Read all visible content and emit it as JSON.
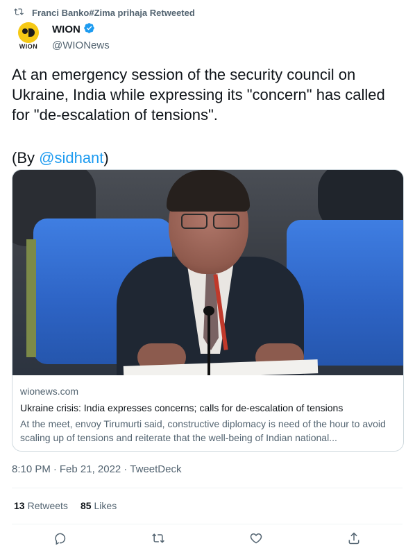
{
  "social_context": {
    "text": "Franci Banko#Zima prihaja Retweeted"
  },
  "author": {
    "display_name": "WION",
    "handle": "@WIONews",
    "avatar_text": "WION"
  },
  "tweet": {
    "text_main": "At an emergency session of the security council on Ukraine, India while expressing its \"concern\" has called for \"de-escalation of tensions\".",
    "by_prefix": "(By ",
    "mention": "@sidhant",
    "by_suffix": ")"
  },
  "card": {
    "domain": "wionews.com",
    "title": "Ukraine crisis: India expresses concerns; calls for de-escalation of tensions",
    "description": "At the meet, envoy Tirumurti said, constructive diplomacy is need of the hour to avoid scaling up of tensions and reiterate that the well-being of Indian national..."
  },
  "meta": {
    "time": "8:10 PM",
    "separator": "·",
    "date": "Feb 21, 2022",
    "source": "TweetDeck"
  },
  "stats": {
    "retweets_count": "13",
    "retweets_label": "Retweets",
    "likes_count": "85",
    "likes_label": "Likes"
  },
  "icons": {
    "retweet_context": "retweet-icon",
    "verified": "verified-badge-icon",
    "reply": "reply-icon",
    "retweet": "retweet-icon",
    "like": "heart-icon",
    "share": "share-icon"
  },
  "colors": {
    "accent": "#1d9bf0",
    "secondary_text": "#536471",
    "primary_text": "#0f1419"
  }
}
